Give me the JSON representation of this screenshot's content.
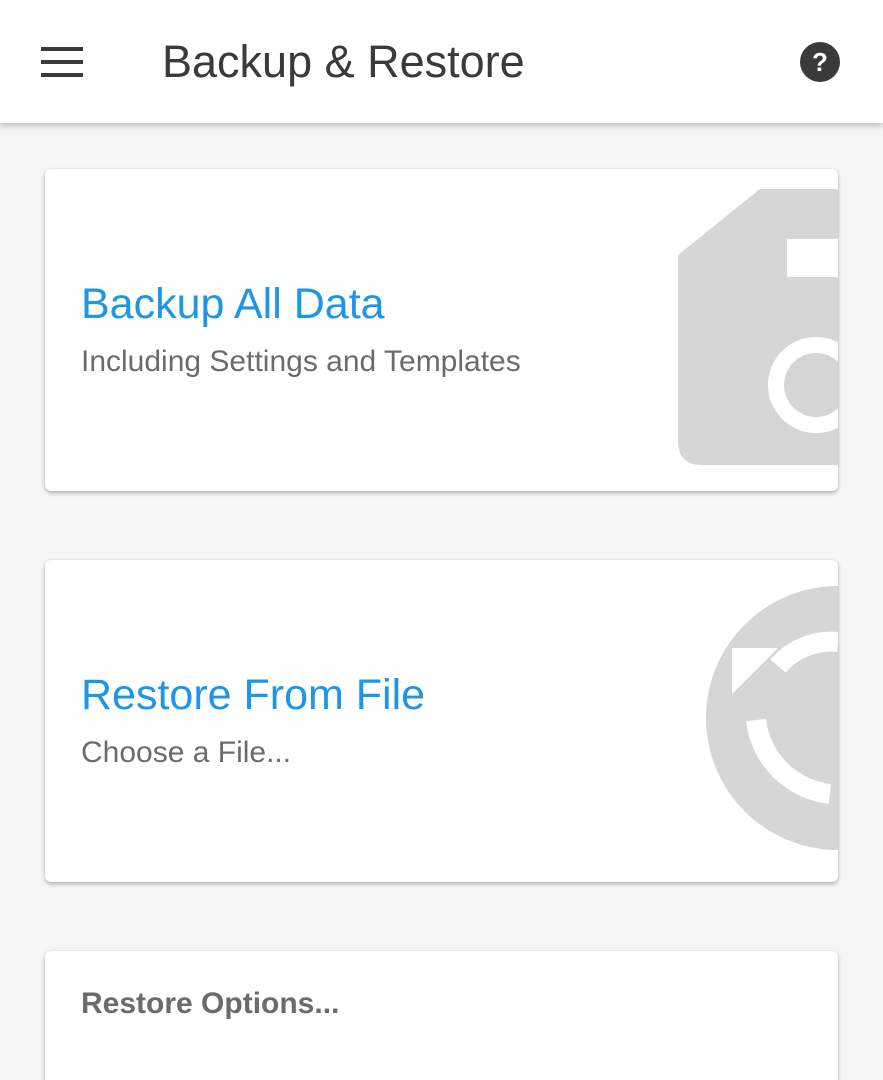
{
  "app_bar": {
    "title": "Backup & Restore",
    "menu_icon": "hamburger-menu-icon",
    "help_icon": "help-circle-icon"
  },
  "cards": {
    "backup": {
      "title": "Backup All Data",
      "subtitle": "Including Settings and Templates",
      "icon": "sd-card-backup-icon"
    },
    "restore": {
      "title": "Restore From File",
      "subtitle": "Choose a File...",
      "icon": "restore-icon"
    },
    "options": {
      "heading": "Restore Options..."
    }
  },
  "colors": {
    "accent": "#1e96e8",
    "title_text": "#3a3a3a",
    "secondary_text": "#6b6b6b",
    "icon_watermark": "#d6d6d6",
    "background": "#f5f5f5",
    "card": "#ffffff"
  }
}
